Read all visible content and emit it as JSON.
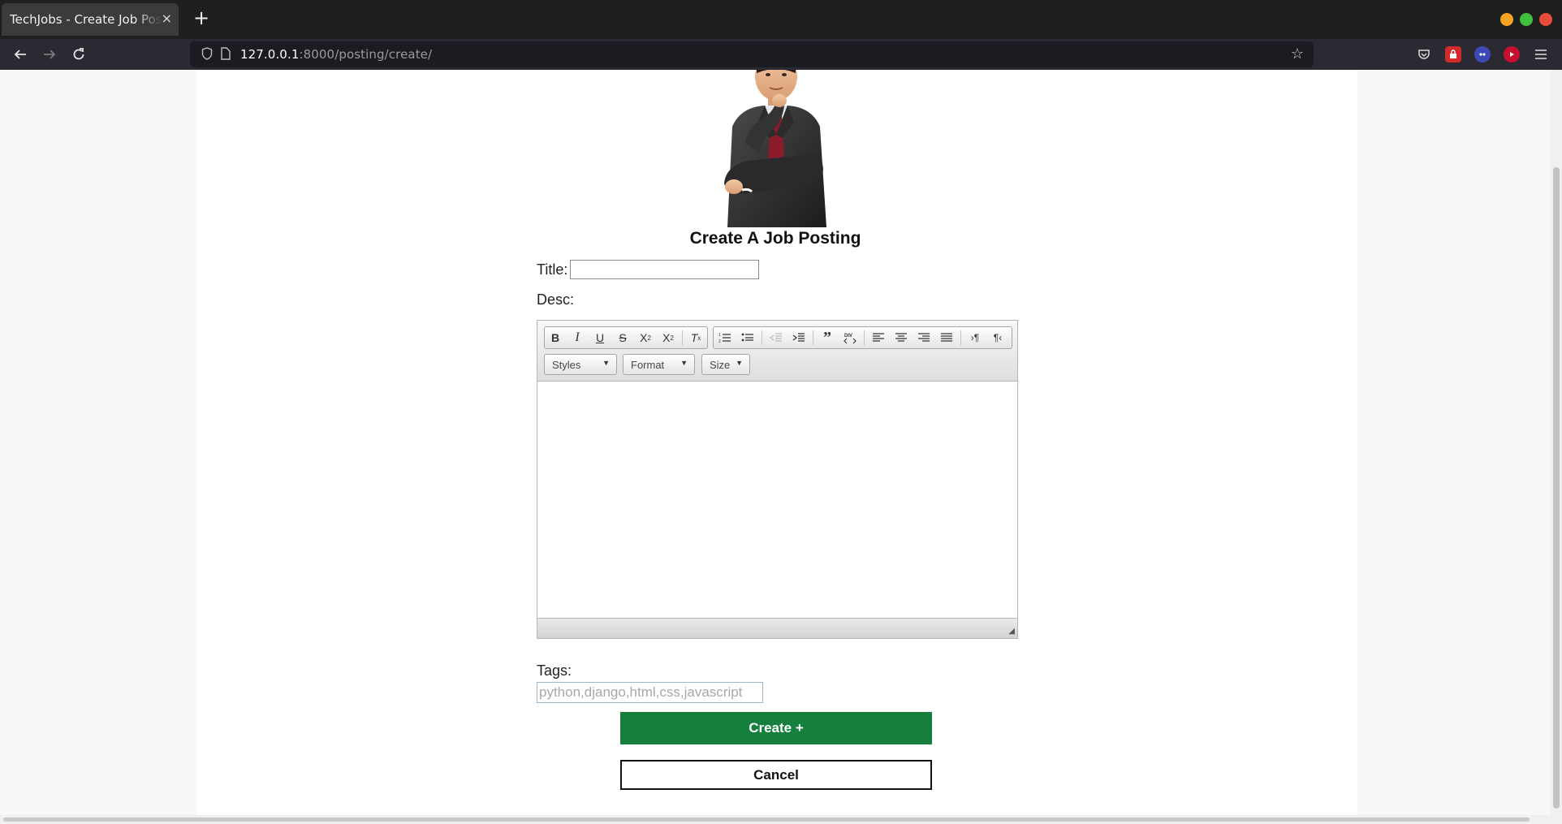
{
  "browser": {
    "tab_title": "TechJobs - Create Job Posting",
    "tab_close": "×",
    "new_tab": "+",
    "url_host": "127.0.0.1",
    "url_rest": ":8000/posting/create/"
  },
  "page": {
    "heading": "Create A Job Posting",
    "title_label": "Title:",
    "title_value": "",
    "desc_label": "Desc:",
    "tags_label": "Tags:",
    "tags_placeholder": "python,django,html,css,javascript",
    "create_button": "Create +",
    "cancel_button": "Cancel"
  },
  "editor": {
    "toolbar_groups": [
      [
        "B",
        "I",
        "U",
        "S",
        "X₂",
        "X²",
        "Tx"
      ],
      [
        "ordered-list",
        "bulleted-list",
        "decrease-indent",
        "increase-indent",
        "blockquote",
        "div",
        "align-left",
        "align-center",
        "align-right",
        "justify",
        "ltr",
        "rtl"
      ]
    ],
    "styles_label": "Styles",
    "format_label": "Format",
    "size_label": "Size",
    "body_text": ""
  },
  "colors": {
    "create_button_bg": "#157f3e",
    "cancel_button_border": "#111111"
  }
}
